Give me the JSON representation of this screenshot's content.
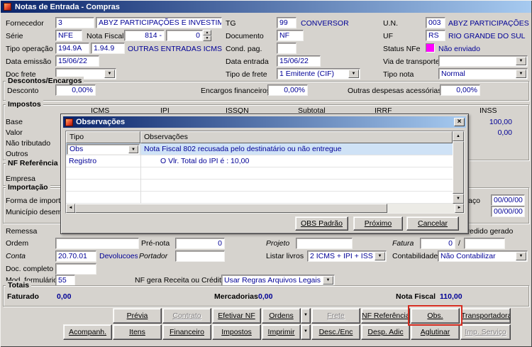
{
  "colors": {
    "titlebar_gradient_start": "#0a246a",
    "titlebar_gradient_end": "#a6caf0",
    "window_bg": "#d6d3ce",
    "value_text": "#000096",
    "status_nfe_swatch": "#ff00ff",
    "selected_row_bg": "#cfe2f6",
    "highlight_box": "#d42a1e"
  },
  "icons": {
    "dropdown": "▼",
    "spin_up": "▲",
    "spin_down": "▼",
    "scroll_up": "▲",
    "scroll_down": "▼",
    "scroll_left": "◄",
    "scroll_right": "►",
    "close": "×"
  },
  "window": {
    "title": "Notas de Entrada - Compras"
  },
  "form": {
    "fornecedor_label": "Fornecedor",
    "fornecedor_code": "3",
    "fornecedor_name": "ABYZ PARTICIPAÇÕES E INVESTIMENTOS LTDA",
    "tg_label": "TG",
    "tg_code": "99",
    "tg_desc": "CONVERSOR",
    "un_label": "U.N.",
    "un_code": "003",
    "un_desc": "ABYZ PARTICIPAÇÕES E INVESTIMENTOS LTDA",
    "serie_label": "Série",
    "serie_value": "NFE",
    "nota_fiscal_label": "Nota Fiscal",
    "nota_fiscal_numero": "814 -",
    "nota_fiscal_sub": "0",
    "documento_label": "Documento",
    "documento_value": "NF",
    "uf_label": "UF",
    "uf_code": "RS",
    "uf_desc": "RIO GRANDE DO SUL",
    "tipo_operacao_label": "Tipo operação",
    "tipo_operacao_code1": "194.9A",
    "tipo_operacao_code2": "1.94.9",
    "tipo_operacao_desc": "OUTRAS ENTRADAS ICMS DIF/IPI SUSP",
    "cond_pag_label": "Cond. pag.",
    "cond_pag_value": "",
    "status_nfe_label": "Status NFe",
    "status_nfe_value": "Não enviado",
    "data_emissao_label": "Data emissão",
    "data_emissao_value": "15/06/22",
    "data_entrada_label": "Data entrada",
    "data_entrada_value": "15/06/22",
    "via_transporte_label": "Via de transporte",
    "via_transporte_value": "",
    "doc_frete_label": "Doc frete",
    "doc_frete_value": "",
    "tipo_frete_label": "Tipo de frete",
    "tipo_frete_value": "1 Emitente (CIF)",
    "tipo_nota_label": "Tipo nota",
    "tipo_nota_value": "Normal"
  },
  "descontos": {
    "legend": "Descontos/Encargos",
    "desconto_label": "Desconto",
    "desconto_value": "0,00%",
    "encargos_label": "Encargos financeiros",
    "encargos_value": "0,00%",
    "outras_label": "Outras despesas acessórias",
    "outras_value": "0,00%"
  },
  "impostos": {
    "legend": "Impostos",
    "columns": [
      "ICMS",
      "IPI",
      "ISSQN",
      "Subtotal",
      "IRRF",
      "INSS"
    ],
    "row_labels": [
      "Base",
      "Valor",
      "Não tributado",
      "Outros"
    ],
    "inss_base_value": "100,00",
    "inss_valor_value": "0,00"
  },
  "nf_referencia": {
    "legend": "NF Referência",
    "empresa_label": "Empresa"
  },
  "importacao": {
    "legend": "Importação",
    "forma_label": "Forma de importação",
    "municipio_label": "Município desembaraço",
    "desembaraco_label": "Desembaraço",
    "data_embarque_value": "00/00/00",
    "data_desembaraco_value": "00/00/00"
  },
  "remessa": {
    "label": "Remessa",
    "pedido_gerado_label": "Pedido gerado"
  },
  "ordem_row": {
    "ordem_label": "Ordem",
    "ordem_value": "",
    "pre_nota_label": "Pré-nota",
    "pre_nota_value": "0",
    "projeto_label": "Projeto",
    "projeto_value": "",
    "fatura_label": "Fatura",
    "fatura_value": "0",
    "fatura_sep": "/",
    "fatura_value2": ""
  },
  "conta_row": {
    "conta_label": "Conta",
    "conta_value": "20.70.01",
    "conta_desc": "Devolucoes de",
    "portador_label": "Portador",
    "portador_value": "",
    "listar_livros_label": "Listar livros",
    "listar_livros_value": "2 ICMS + IPI + ISS",
    "contabilidade_label": "Contabilidade",
    "contabilidade_value": "Não Contabilizar"
  },
  "doc_completo": {
    "label": "Doc. completo",
    "value": ""
  },
  "mod_formulario": {
    "label": "Mod. formulário",
    "value": "55",
    "nf_gera_label": "NF gera Receita ou Crédito",
    "nf_gera_value": "Usar Regras Arquivos Legais"
  },
  "totais": {
    "legend": "Totais",
    "faturado_label": "Faturado",
    "faturado_value": "0,00",
    "mercadorias_label": "Mercadorias",
    "mercadorias_value": "0,00",
    "nota_fiscal_label": "Nota Fiscal",
    "nota_fiscal_value": "110,00"
  },
  "action_buttons_row1": [
    {
      "label": "Prévia"
    },
    {
      "label": "Contrato",
      "disabled": true
    },
    {
      "label": "Efetivar NF"
    },
    {
      "label": "Ordens",
      "dropdown": true
    },
    {
      "label": "Frete",
      "disabled": true
    },
    {
      "label": "NF Referência"
    },
    {
      "label": "Obs.",
      "highlighted": true
    },
    {
      "label": "Transportadora"
    }
  ],
  "action_buttons_row2": [
    {
      "label": "Acompanh."
    },
    {
      "label": "Itens"
    },
    {
      "label": "Financeiro"
    },
    {
      "label": "Impostos"
    },
    {
      "label": "Imprimir",
      "dropdown": true
    },
    {
      "label": "Desc./Enc"
    },
    {
      "label": "Desp. Adic"
    },
    {
      "label": "Aglutinar"
    },
    {
      "label": "Imp. Serviço",
      "disabled": true
    }
  ],
  "modal": {
    "title": "Observações",
    "grid": {
      "col_tipo": "Tipo",
      "col_observacoes": "Observações",
      "rows": [
        {
          "tipo": "Obs",
          "observacao": "Nota Fiscal 802 recusada pelo destinatário ou não entregue"
        },
        {
          "tipo": "Registro",
          "observacao": "O Vlr. Total do IPI é : 10,00"
        }
      ]
    },
    "buttons": {
      "obs_padrao": "OBS Padrão",
      "proximo": "Próximo",
      "cancelar": "Cancelar"
    }
  }
}
